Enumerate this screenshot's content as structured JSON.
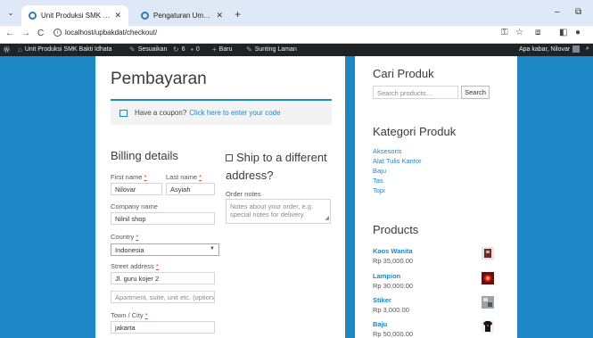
{
  "browser": {
    "tabs": [
      {
        "title": "Unit Produksi SMK Bakti Idhata",
        "active": true
      },
      {
        "title": "Pengaturan Umum ‹ Unit Produ",
        "active": false
      }
    ],
    "new_tab": "+",
    "url": "localhost/upbakdat/checkout/",
    "icons": {
      "back": "←",
      "forward": "→",
      "reload": "C",
      "minimize": "–",
      "restore": "⧉"
    }
  },
  "admin_bar": {
    "site": "Unit Produksi SMK Bakti Idhata",
    "customize": "Sesuaikan",
    "updates": "6",
    "comments": "0",
    "new": "Baru",
    "edit": "Sunting Laman",
    "greeting": "Apa kabar, Nilovar"
  },
  "main": {
    "title": "Pembayaran",
    "coupon_text": "Have a coupon?",
    "coupon_link": "Click here to enter your code",
    "billing_heading": "Billing details",
    "ship_heading": "Ship to a different address?",
    "order_notes_label": "Order notes",
    "order_notes_placeholder": "Notes about your order, e.g. special notes for delivery.",
    "fields": {
      "first_name_label": "First name",
      "first_name": "Nilovar",
      "last_name_label": "Last name",
      "last_name": "Asyiah",
      "company_label": "Company name",
      "company": "Nilnil shop",
      "country_label": "Country",
      "country": "Indonesia",
      "street_label": "Street address",
      "street1": "Jl. guru kojer 2",
      "street2_placeholder": "Apartment, suite, unit etc. (optional)",
      "city_label": "Town / City",
      "city": "jakarta"
    },
    "required_mark": "*"
  },
  "sidebar": {
    "search_heading": "Cari Produk",
    "search_placeholder": "Search products…",
    "search_button": "Search",
    "categories_heading": "Kategori Produk",
    "categories": [
      "Aksesoris",
      "Alat Tulis Kantor",
      "Baju",
      "Tas",
      "Topi"
    ],
    "products_heading": "Products",
    "products": [
      {
        "name": "Kaos Wanita",
        "price": "Rp 35,000.00"
      },
      {
        "name": "Lampion",
        "price": "Rp 30,000.00"
      },
      {
        "name": "Stiker",
        "price": "Rp 3,000.00"
      },
      {
        "name": "Baju",
        "price": "Rp 50,000.00"
      }
    ]
  },
  "colors": {
    "accent": "#1e88c7",
    "admin_bar": "#1d2327",
    "required": "#e2401c"
  }
}
